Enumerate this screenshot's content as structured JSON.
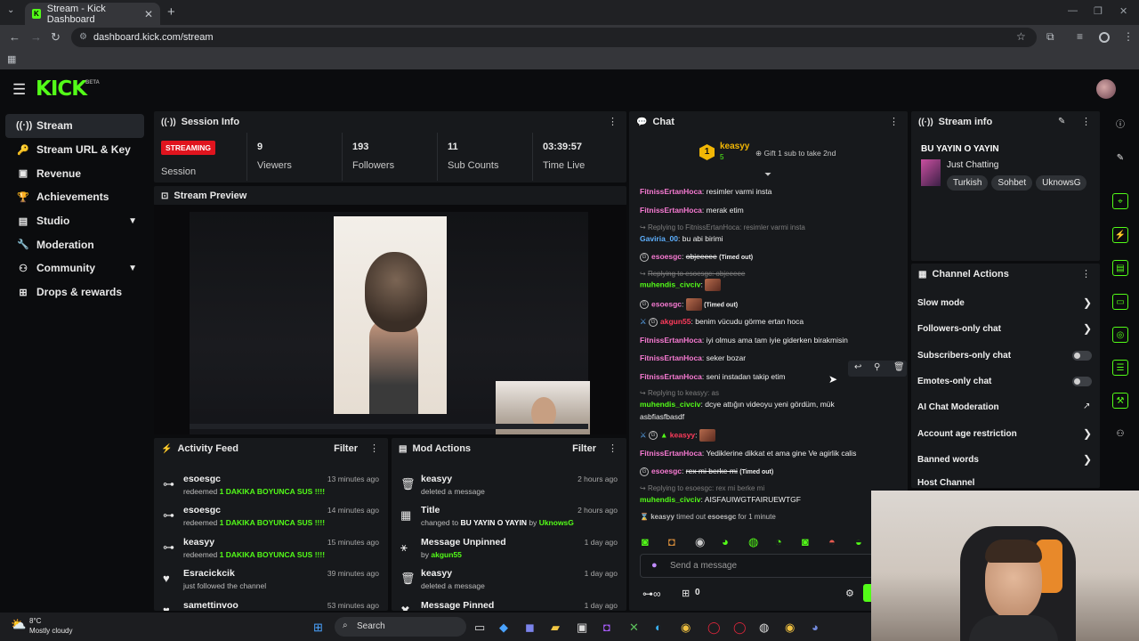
{
  "browser": {
    "tab_title": "Stream - Kick Dashboard",
    "url": "dashboard.kick.com/stream"
  },
  "header": {
    "logo": "KICK",
    "beta": "BETA"
  },
  "sidebar": {
    "items": [
      {
        "label": "Stream",
        "icon": "broadcast-icon"
      },
      {
        "label": "Stream URL & Key",
        "icon": "key-icon"
      },
      {
        "label": "Revenue",
        "icon": "revenue-icon"
      },
      {
        "label": "Achievements",
        "icon": "trophy-icon"
      },
      {
        "label": "Studio",
        "icon": "studio-icon"
      },
      {
        "label": "Moderation",
        "icon": "wrench-icon"
      },
      {
        "label": "Community",
        "icon": "community-icon"
      },
      {
        "label": "Drops & rewards",
        "icon": "gift-icon"
      }
    ]
  },
  "session": {
    "title": "Session Info",
    "status": "STREAMING",
    "status_label": "Session",
    "viewers": "9",
    "viewers_label": "Viewers",
    "followers": "193",
    "followers_label": "Followers",
    "subs": "11",
    "subs_label": "Sub Counts",
    "time": "03:39:57",
    "time_label": "Time Live"
  },
  "preview": {
    "title": "Stream Preview"
  },
  "activity": {
    "title": "Activity Feed",
    "filter": "Filter",
    "rows": [
      {
        "name": "esoesgc",
        "pre": "redeemed",
        "hl": "1 DAKIKA BOYUNCA SUS !!!!",
        "time": "13 minutes ago"
      },
      {
        "name": "esoesgc",
        "pre": "redeemed",
        "hl": "1 DAKIKA BOYUNCA SUS !!!!",
        "time": "14 minutes ago"
      },
      {
        "name": "keasyy",
        "pre": "redeemed",
        "hl": "1 DAKIKA BOYUNCA SUS !!!!",
        "time": "15 minutes ago"
      },
      {
        "name": "Esracickcik",
        "pre": "just followed the channel",
        "hl": "",
        "time": "39 minutes ago"
      },
      {
        "name": "samettinvoo",
        "pre": "",
        "hl": "",
        "time": "53 minutes ago"
      }
    ]
  },
  "modactions": {
    "title": "Mod Actions",
    "filter": "Filter",
    "rows": [
      {
        "name": "keasyy",
        "sub": "deleted a message",
        "time": "2 hours ago"
      },
      {
        "name": "Title",
        "sub_pre": "changed to",
        "sub_b": "BU YAYIN O YAYIN",
        "sub_by": "by",
        "sub_user": "UknowsG",
        "time": "2 hours ago"
      },
      {
        "name": "Message Unpinned",
        "sub_by": "by",
        "sub_user": "akgun55",
        "time": "1 day ago"
      },
      {
        "name": "keasyy",
        "sub": "deleted a message",
        "time": "1 day ago"
      },
      {
        "name": "Message Pinned",
        "time": "1 day ago"
      }
    ]
  },
  "chat": {
    "title": "Chat",
    "top_user": "keasyy",
    "top_rank": "1",
    "top_count": "5",
    "gift_text": "Gift 1 sub to take 2nd",
    "messages": [
      {
        "user": "FitnissErtanHoca",
        "text": "resimler varmi insta"
      },
      {
        "user": "FitnissErtanHoca",
        "text": "merak etim"
      },
      {
        "reply": "Replying to FitnissErtanHoca: resimler varmi insta"
      },
      {
        "user": "Gaviria_00",
        "text": "bu abi birimi"
      },
      {
        "user": "esoesgc",
        "text": "objeeeee",
        "timed": "(Timed out)"
      },
      {
        "reply": "Replying to esoesgc: objeeeee"
      },
      {
        "user": "muhendis_civciv",
        "text": ""
      },
      {
        "user": "esoesgc",
        "text": "",
        "timed": "(Timed out)"
      },
      {
        "user": "akgun55",
        "text": "benim vücudu görme ertan hoca"
      },
      {
        "user": "FitnissErtanHoca",
        "text": "iyi olmus ama tam iyie giderken birakmisin"
      },
      {
        "user": "FitnissErtanHoca",
        "text": "seker bozar"
      },
      {
        "user": "FitnissErtanHoca",
        "text": "seni instadan takip etim"
      },
      {
        "reply": "Replying to keasyy: as"
      },
      {
        "user": "muhendis_civciv",
        "text": "dcye attığın videoyu yeni gördüm, mük",
        "text2": "asbfiasfbasdf"
      },
      {
        "user": "keasyy",
        "text": ""
      },
      {
        "user": "FitnissErtanHoca",
        "text": "Yediklerine dikkat et ama gine Ve agirlik calis"
      },
      {
        "user": "esoesgc",
        "text": "rex mi berke mi",
        "timed": "(Timed out)"
      },
      {
        "reply": "Replying to esoesgc: rex mi berke mi"
      },
      {
        "user": "muhendis_civciv",
        "text": "AISFAUIWGTFAIRUEWTGF"
      },
      {
        "system_user": "keasyy",
        "system_mid": "timed out",
        "system_target": "esoesgc",
        "system_tail": "for 1 minute"
      }
    ],
    "placeholder": "Send a message",
    "count_text": "0"
  },
  "stream_info": {
    "title": "Stream info",
    "stream_title": "BU YAYIN O YAYIN",
    "category": "Just Chatting",
    "tags": [
      "Turkish",
      "Sohbet",
      "UknowsG"
    ]
  },
  "channel_actions": {
    "title": "Channel Actions",
    "items": [
      {
        "label": "Slow mode",
        "ctrl": "arrow"
      },
      {
        "label": "Followers-only chat",
        "ctrl": "arrow"
      },
      {
        "label": "Subscribers-only chat",
        "ctrl": "toggle"
      },
      {
        "label": "Emotes-only chat",
        "ctrl": "toggle"
      },
      {
        "label": "AI Chat Moderation",
        "ctrl": "external"
      },
      {
        "label": "Account age restriction",
        "ctrl": "arrow"
      },
      {
        "label": "Banned words",
        "ctrl": "arrow"
      },
      {
        "label": "Host Channel",
        "ctrl": "none"
      }
    ]
  },
  "taskbar": {
    "weather_temp": "8°C",
    "weather_desc": "Mostly cloudy",
    "search": "Search"
  },
  "colors": {
    "accent": "#53fc18",
    "live": "#e0141e",
    "panel": "#17191c"
  }
}
